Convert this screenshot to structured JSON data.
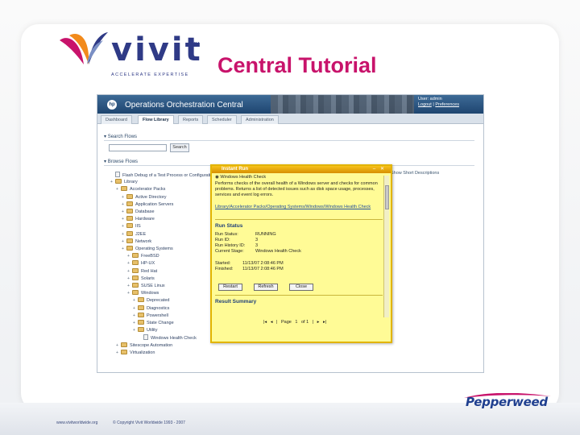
{
  "slide": {
    "logo_word": "vivit",
    "logo_tm": "TM",
    "logo_tagline": "ACCELERATE EXPERTISE",
    "title": "Central Tutorial",
    "footer_link": "www.vivitworldwide.org",
    "footer_copy": "© Copyright Vivit Worldwide 1993 - 2007",
    "partner_logo": "Pepperweed",
    "colors": {
      "title": "#c8136b",
      "brand_blue": "#2f3a86"
    }
  },
  "app": {
    "title": "Operations Orchestration Central",
    "logo_label": "hp",
    "user": {
      "name": "User: admin",
      "logout": "Logout",
      "preferences": "Preferences"
    },
    "tabs": [
      "Dashboard",
      "Flow Library",
      "Reports",
      "Scheduler",
      "Administration"
    ],
    "active_tab": "Flow Library",
    "search": {
      "header": "Search Flows",
      "button": "Search",
      "value": ""
    },
    "browse_header": "Browse Flows",
    "show_descriptions": "Show Short Descriptions",
    "tree": [
      {
        "label": "Flash Debug of a Test Process or Configuration",
        "level": 0,
        "kind": "file"
      },
      {
        "label": "Library",
        "level": 0,
        "kind": "folder"
      },
      {
        "label": "Accelerator Packs",
        "level": 1,
        "kind": "folder"
      },
      {
        "label": "Active Directory",
        "level": 2,
        "kind": "folder"
      },
      {
        "label": "Application Servers",
        "level": 2,
        "kind": "folder"
      },
      {
        "label": "Database",
        "level": 2,
        "kind": "folder"
      },
      {
        "label": "Hardware",
        "level": 2,
        "kind": "folder"
      },
      {
        "label": "IIS",
        "level": 2,
        "kind": "folder"
      },
      {
        "label": "J2EE",
        "level": 2,
        "kind": "folder"
      },
      {
        "label": "Network",
        "level": 2,
        "kind": "folder"
      },
      {
        "label": "Operating Systems",
        "level": 2,
        "kind": "folder"
      },
      {
        "label": "FreeBSD",
        "level": 3,
        "kind": "folder"
      },
      {
        "label": "HP-UX",
        "level": 3,
        "kind": "folder"
      },
      {
        "label": "Red Hat",
        "level": 3,
        "kind": "folder"
      },
      {
        "label": "Solaris",
        "level": 3,
        "kind": "folder"
      },
      {
        "label": "SUSE Linux",
        "level": 3,
        "kind": "folder"
      },
      {
        "label": "Windows",
        "level": 3,
        "kind": "folder"
      },
      {
        "label": "Deprecated",
        "level": 4,
        "kind": "folder"
      },
      {
        "label": "Diagnostics",
        "level": 4,
        "kind": "folder"
      },
      {
        "label": "Powershell",
        "level": 4,
        "kind": "folder"
      },
      {
        "label": "State Change",
        "level": 4,
        "kind": "folder"
      },
      {
        "label": "Utility",
        "level": 4,
        "kind": "folder"
      },
      {
        "label": "Windows Health Check",
        "level": 5,
        "kind": "file"
      },
      {
        "label": "Sitescope Automation",
        "level": 1,
        "kind": "folder"
      },
      {
        "label": "Virtualization",
        "level": 1,
        "kind": "folder"
      }
    ],
    "dialog": {
      "title": "Instant Run",
      "flow_name": "Windows Health Check",
      "description": "Performs checks of the overall health of a Windows server and checks for common problems. Returns a list of detected issues such as disk space usage, processes, services and event log errors.",
      "path_label": "Library/Accelerator Packs/Operating Systems/Windows/Windows Health Check",
      "run_status_header": "Run Status",
      "fields": [
        {
          "label": "Run Status:",
          "value": "RUNNING"
        },
        {
          "label": "Run ID:",
          "value": "3"
        },
        {
          "label": "Run History ID:",
          "value": "3"
        },
        {
          "label": "Current Stage:",
          "value": "Windows Health Check"
        }
      ],
      "started": {
        "label": "Started:",
        "value": "11/13/07 2:08:46 PM"
      },
      "finished": {
        "label": "Finished:",
        "value": "11/13/07 2:08:46 PM"
      },
      "buttons": [
        "Restart",
        "Refresh",
        "Close"
      ],
      "result_summary_header": "Result Summary",
      "pager": {
        "page_label": "Page",
        "page": "1",
        "of_label": "of 1"
      }
    }
  }
}
